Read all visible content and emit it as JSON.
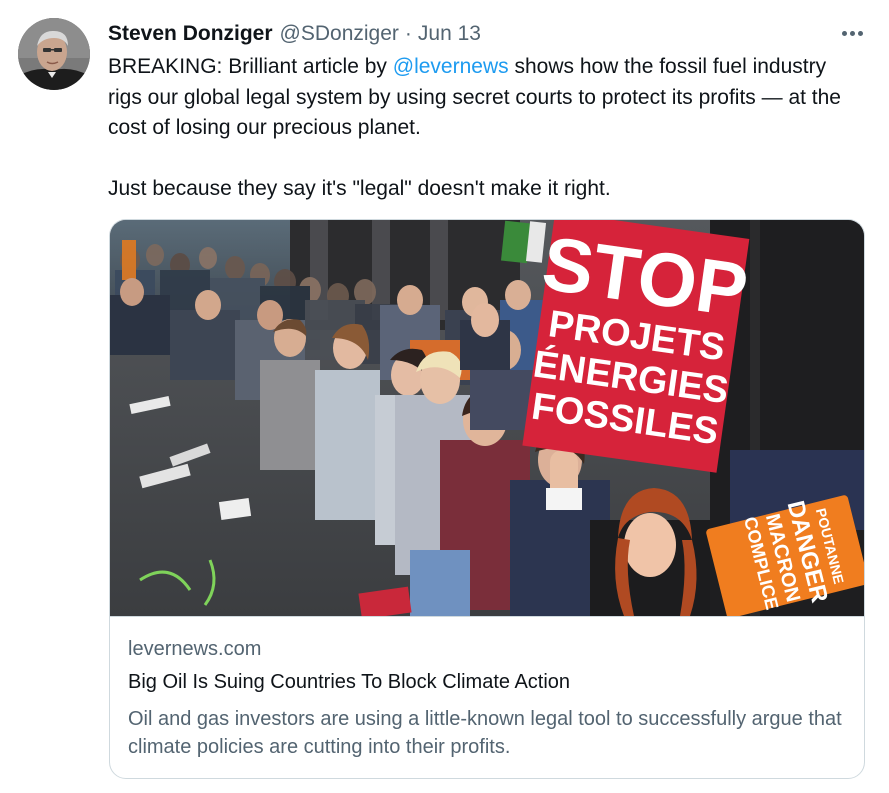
{
  "tweet": {
    "author_name": "Steven Donziger",
    "author_handle": "@SDonziger",
    "separator": "·",
    "date": "Jun 13",
    "text_1": "BREAKING: Brilliant article by ",
    "mention": "@levernews",
    "text_2": " shows how the fossil fuel industry rigs our global legal system by using secret courts to protect its profits — at the cost of losing our precious planet.",
    "text_3": "Just because they say it's \"legal\" doesn't make it right."
  },
  "card": {
    "domain": "levernews.com",
    "title": "Big Oil Is Suing Countries To Block Climate Action",
    "description": "Oil and gas investors are using a little-known legal tool to successfully argue that climate policies are cutting into their profits.",
    "image": {
      "sign_line_1": "STOP",
      "sign_line_2": "PROJETS",
      "sign_line_3": "ÉNERGIES",
      "sign_line_4": "FOSSILES",
      "orange_sign_1": "POUTANNE",
      "orange_sign_2": "DANGER",
      "orange_sign_3": "MACRON",
      "orange_sign_4": "COMPLICE"
    }
  },
  "colors": {
    "link": "#1d9bf0",
    "secondary_text": "#536471",
    "border": "#cfd9de",
    "sign_red": "#d6233a",
    "sign_orange": "#f07d1f"
  },
  "icons": {
    "more": "more-horizontal-icon"
  }
}
